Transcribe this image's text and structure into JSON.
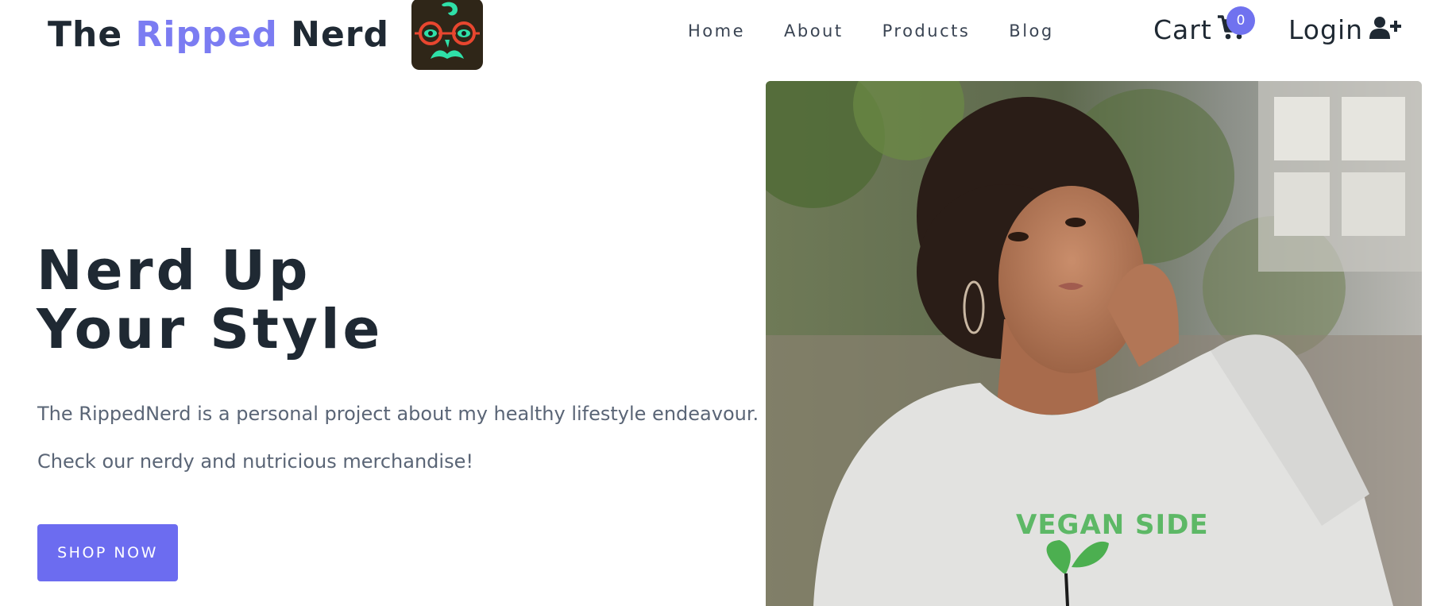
{
  "brand": {
    "part1": "The ",
    "part2": "Ripped",
    "part3": " Nerd"
  },
  "nav": {
    "items": [
      {
        "label": "Home"
      },
      {
        "label": "About"
      },
      {
        "label": "Products"
      },
      {
        "label": "Blog"
      }
    ]
  },
  "cart": {
    "label": "Cart",
    "count": "0",
    "icon": "shopping-cart-icon"
  },
  "login": {
    "label": "Login",
    "icon": "user-plus-icon"
  },
  "hero": {
    "title_line1": "Nerd Up",
    "title_line2": "Your Style",
    "paragraph1": "The RippedNerd is a personal project about my healthy lifestyle endeavour.",
    "paragraph2": "Check our nerdy and nutricious merchandise!",
    "cta_label": "SHOP NOW",
    "image": {
      "shirt_text": "VEGAN SIDE"
    }
  },
  "colors": {
    "accent": "#6c6cf0",
    "text_dark": "#1f2933",
    "text_muted": "#5a6576",
    "logo_bg": "#2f2618",
    "logo_green": "#2fe0a8",
    "logo_red": "#e8462f"
  }
}
